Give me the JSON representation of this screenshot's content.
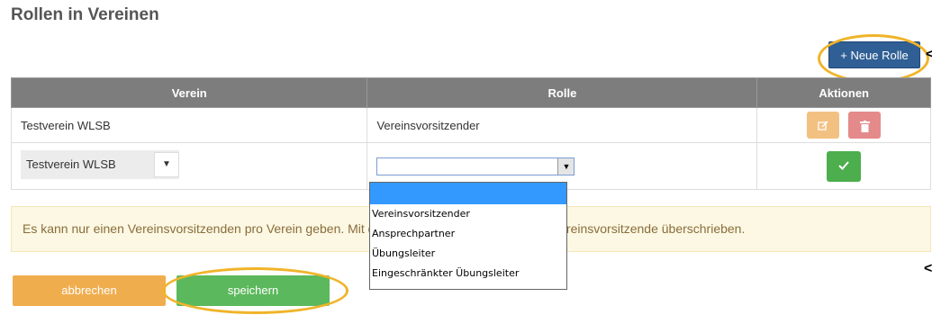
{
  "page": {
    "title": "Rollen in Vereinen"
  },
  "toolbar": {
    "new_role_label": "+ Neue Rolle"
  },
  "table": {
    "headers": {
      "verein": "Verein",
      "rolle": "Rolle",
      "aktionen": "Aktionen"
    },
    "rows": [
      {
        "verein": "Testverein WLSB",
        "rolle": "Vereinsvorsitzender"
      }
    ],
    "edit_row": {
      "verein_selected": "Testverein WLSB",
      "rolle_selected": ""
    }
  },
  "icons": {
    "edit": "edit-icon",
    "delete": "trash-icon",
    "confirm": "check-icon",
    "dropdown": "chevron-down-icon"
  },
  "info": {
    "text": "Es kann nur einen Vereinsvorsitzenden pro Verein geben. Mit dem Speichern wird der aktuelle Vereinsvorsitzende überschrieben."
  },
  "dropdown": {
    "options": [
      "",
      "Vereinsvorsitzender",
      "Ansprechpartner",
      "Übungsleiter",
      "Eingeschränkter Übungsleiter"
    ]
  },
  "actions": {
    "cancel_label": "abbrechen",
    "save_label": "speichern"
  },
  "colors": {
    "header": "#7d7d7d",
    "primary": "#2f5f94",
    "warning": "#f0ad4e",
    "success": "#5cb85c",
    "highlight_ring": "#f0b429"
  }
}
